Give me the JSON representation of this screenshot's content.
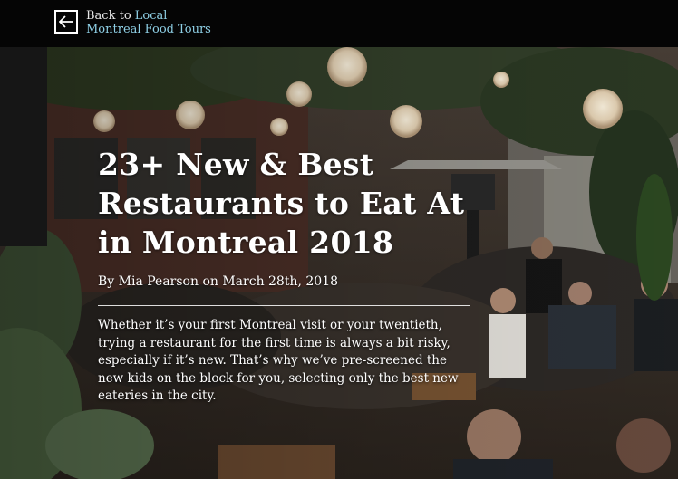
{
  "nav": {
    "back_prefix": "Back to",
    "back_accent": "Local",
    "back_line2": "Montreal Food Tours"
  },
  "article": {
    "title": "23+ New & Best Restaurants to Eat At in Montreal 2018",
    "byline": "By Mia Pearson on March 28th, 2018",
    "intro": "Whether it’s your first Montreal visit or your twentieth, trying a restaurant for the first time is always a bit risky, especially if it’s new. That’s why we’ve pre-screened the new kids on the block for you, selecting only the best new eateries in the city."
  },
  "hero_image": {
    "description_icon": "restaurant-terrace-photo"
  }
}
